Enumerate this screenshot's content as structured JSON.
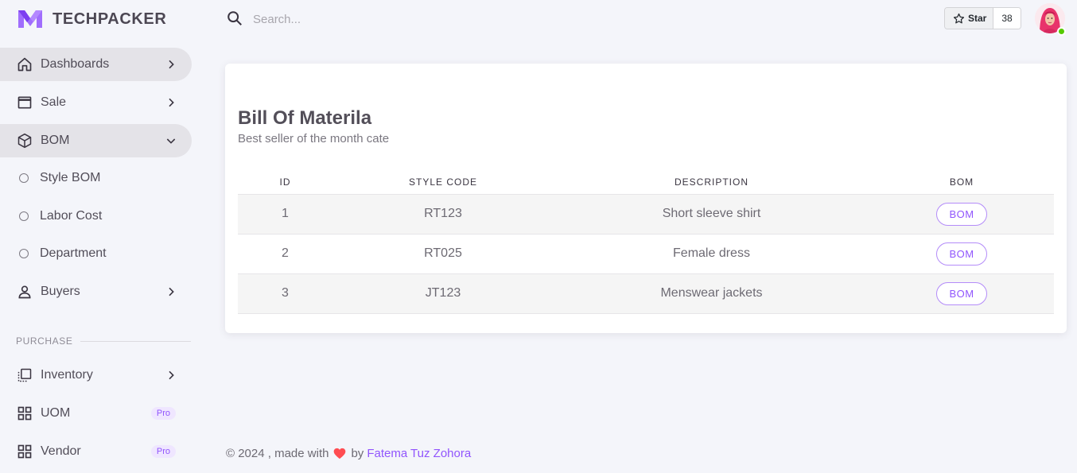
{
  "brand": {
    "name": "TECHPACKER",
    "accent": "#9155fd"
  },
  "search": {
    "placeholder": "Search..."
  },
  "github": {
    "star_label": "Star",
    "star_count": "38"
  },
  "sidebar": {
    "items": [
      {
        "label": "Dashboards",
        "icon": "home-icon",
        "active": true
      },
      {
        "label": "Sale",
        "icon": "window-icon"
      },
      {
        "label": "BOM",
        "icon": "cube-icon",
        "active": true,
        "expanded": true
      },
      {
        "label": "Style BOM",
        "icon": "circle-icon"
      },
      {
        "label": "Labor Cost",
        "icon": "circle-icon"
      },
      {
        "label": "Department",
        "icon": "circle-icon"
      },
      {
        "label": "Buyers",
        "icon": "account-icon"
      }
    ],
    "section_purchase": "PURCHASE",
    "purchase_items": [
      {
        "label": "Inventory",
        "icon": "list-icon"
      },
      {
        "label": "UOM",
        "icon": "grid-icon",
        "badge": "Pro"
      },
      {
        "label": "Vendor",
        "icon": "grid-icon",
        "badge": "Pro"
      }
    ]
  },
  "card": {
    "title": "Bill Of Materila",
    "subtitle": "Best seller of the month cate",
    "columns": [
      "ID",
      "STYLE CODE",
      "DESCRIPTION",
      "BOM"
    ],
    "rows": [
      {
        "id": "1",
        "style_code": "RT123",
        "description": "Short sleeve shirt",
        "bom": "BOM"
      },
      {
        "id": "2",
        "style_code": "RT025",
        "description": "Female dress",
        "bom": "BOM"
      },
      {
        "id": "3",
        "style_code": "JT123",
        "description": "Menswear jackets",
        "bom": "BOM"
      }
    ]
  },
  "footer": {
    "prefix": "© 2024 , made with",
    "by": "by",
    "author": "Fatema Tuz Zohora"
  }
}
